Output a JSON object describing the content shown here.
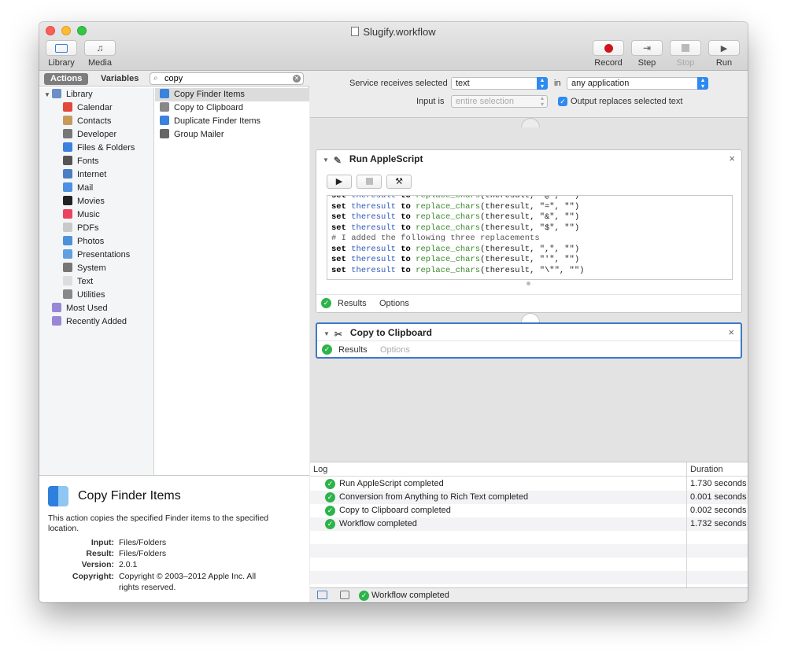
{
  "window": {
    "title": "Slugify.workflow"
  },
  "toolbar": {
    "library_label": "Library",
    "media_label": "Media",
    "record_label": "Record",
    "step_label": "Step",
    "stop_label": "Stop",
    "run_label": "Run"
  },
  "left": {
    "tab_actions": "Actions",
    "tab_variables": "Variables",
    "search_value": "copy",
    "library": [
      {
        "label": "Library",
        "icon": "library-icon",
        "color": "#6b8ec9"
      },
      {
        "label": "Calendar",
        "icon": "calendar-icon",
        "color": "#e14a3b"
      },
      {
        "label": "Contacts",
        "icon": "contacts-icon",
        "color": "#c79a5a"
      },
      {
        "label": "Developer",
        "icon": "developer-icon",
        "color": "#777777"
      },
      {
        "label": "Files & Folders",
        "icon": "finder-icon",
        "color": "#3a82de"
      },
      {
        "label": "Fonts",
        "icon": "fonts-icon",
        "color": "#555555"
      },
      {
        "label": "Internet",
        "icon": "internet-icon",
        "color": "#4a7fc1"
      },
      {
        "label": "Mail",
        "icon": "mail-icon",
        "color": "#4d8fe0"
      },
      {
        "label": "Movies",
        "icon": "movies-icon",
        "color": "#222222"
      },
      {
        "label": "Music",
        "icon": "music-icon",
        "color": "#e9435f"
      },
      {
        "label": "PDFs",
        "icon": "pdfs-icon",
        "color": "#c9c9c9"
      },
      {
        "label": "Photos",
        "icon": "photos-icon",
        "color": "#4d91d8"
      },
      {
        "label": "Presentations",
        "icon": "presentations-icon",
        "color": "#5fa0e0"
      },
      {
        "label": "System",
        "icon": "system-icon",
        "color": "#777777"
      },
      {
        "label": "Text",
        "icon": "text-icon",
        "color": "#dddddd"
      },
      {
        "label": "Utilities",
        "icon": "utilities-icon",
        "color": "#888888"
      },
      {
        "label": "Most Used",
        "icon": "smart-folder-icon",
        "color": "#9a86d6"
      },
      {
        "label": "Recently Added",
        "icon": "smart-folder-icon",
        "color": "#9a86d6"
      }
    ],
    "actions": [
      {
        "label": "Copy Finder Items",
        "icon": "finder-icon",
        "color": "#3a82de"
      },
      {
        "label": "Copy to Clipboard",
        "icon": "utilities-icon",
        "color": "#888888"
      },
      {
        "label": "Duplicate Finder Items",
        "icon": "finder-icon",
        "color": "#3a82de"
      },
      {
        "label": "Group Mailer",
        "icon": "mailer-icon",
        "color": "#666666"
      }
    ],
    "description": {
      "title": "Copy Finder Items",
      "text": "This action copies the specified Finder items to the specified location.",
      "input_key": "Input:",
      "input": "Files/Folders",
      "result_key": "Result:",
      "result": "Files/Folders",
      "version_key": "Version:",
      "version": "2.0.1",
      "copyright_key": "Copyright:",
      "copyright": "Copyright © 2003–2012 Apple Inc.  All rights reserved."
    }
  },
  "service": {
    "receives_label": "Service receives selected",
    "receives_value": "text",
    "in_label": "in",
    "in_value": "any application",
    "input_is_label": "Input is",
    "input_is_value": "entire selection",
    "replaces_label": "Output replaces selected text"
  },
  "actions": [
    {
      "title": "Run AppleScript",
      "results": "Results",
      "options": "Options",
      "code": [
        {
          "kw": "set",
          "var": "theresult",
          "to": "to",
          "fn": "replace_chars",
          "args": "(theresult, \"@\", \"\")"
        },
        {
          "kw": "set",
          "var": "theresult",
          "to": "to",
          "fn": "replace_chars",
          "args": "(theresult, \"=\", \"\")"
        },
        {
          "kw": "set",
          "var": "theresult",
          "to": "to",
          "fn": "replace_chars",
          "args": "(theresult, \"&\", \"\")"
        },
        {
          "kw": "set",
          "var": "theresult",
          "to": "to",
          "fn": "replace_chars",
          "args": "(theresult, \"$\", \"\")"
        },
        {
          "comment": "# I added the following three replacements"
        },
        {
          "kw": "set",
          "var": "theresult",
          "to": "to",
          "fn": "replace_chars",
          "args": "(theresult, \",\", \"\")"
        },
        {
          "kw": "set",
          "var": "theresult",
          "to": "to",
          "fn": "replace_chars",
          "args": "(theresult, \"'\", \"\")"
        },
        {
          "kw": "set",
          "var": "theresult",
          "to": "to",
          "fn": "replace_chars",
          "args": "(theresult, \"\\\"\", \"\")"
        }
      ]
    },
    {
      "title": "Copy to Clipboard",
      "results": "Results",
      "options": "Options"
    }
  ],
  "log": {
    "col_log": "Log",
    "col_duration": "Duration",
    "rows": [
      {
        "message": "Run AppleScript completed",
        "duration": "1.730 seconds"
      },
      {
        "message": "Conversion from Anything to Rich Text completed",
        "duration": "0.001 seconds"
      },
      {
        "message": "Copy to Clipboard completed",
        "duration": "0.002 seconds"
      },
      {
        "message": "Workflow completed",
        "duration": "1.732 seconds"
      }
    ]
  },
  "status": {
    "text": "Workflow completed"
  }
}
